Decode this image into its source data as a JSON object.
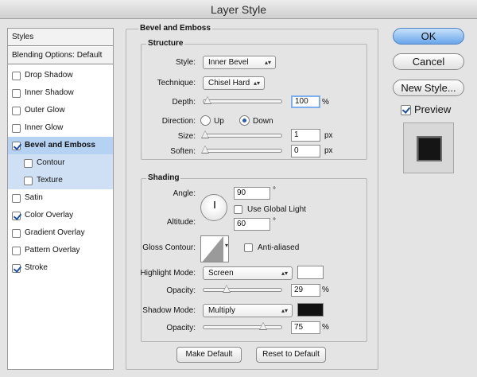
{
  "window": {
    "title": "Layer Style"
  },
  "styles_panel": {
    "header": "Styles",
    "blending": "Blending Options: Default",
    "items": [
      {
        "label": "Drop Shadow",
        "checked": false
      },
      {
        "label": "Inner Shadow",
        "checked": false
      },
      {
        "label": "Outer Glow",
        "checked": false
      },
      {
        "label": "Inner Glow",
        "checked": false
      },
      {
        "label": "Bevel and Emboss",
        "checked": true
      },
      {
        "label": "Contour",
        "checked": false
      },
      {
        "label": "Texture",
        "checked": false
      },
      {
        "label": "Satin",
        "checked": false
      },
      {
        "label": "Color Overlay",
        "checked": true
      },
      {
        "label": "Gradient Overlay",
        "checked": false
      },
      {
        "label": "Pattern Overlay",
        "checked": false
      },
      {
        "label": "Stroke",
        "checked": true
      }
    ]
  },
  "bevel": {
    "title": "Bevel and Emboss",
    "structure": {
      "title": "Structure",
      "style_label": "Style:",
      "style_value": "Inner Bevel",
      "technique_label": "Technique:",
      "technique_value": "Chisel Hard",
      "depth_label": "Depth:",
      "depth_value": "100",
      "depth_unit": "%",
      "depth_level": 0.0,
      "direction_label": "Direction:",
      "direction_up": "Up",
      "direction_down": "Down",
      "direction_selected": "Down",
      "size_label": "Size:",
      "size_value": "1",
      "size_unit": "px",
      "soften_label": "Soften:",
      "soften_value": "0",
      "soften_unit": "px"
    },
    "shading": {
      "title": "Shading",
      "angle_label": "Angle:",
      "angle_value": "90",
      "degree": "°",
      "global_light_label": "Use Global Light",
      "global_light_checked": false,
      "altitude_label": "Altitude:",
      "altitude_value": "60",
      "gloss_label": "Gloss Contour:",
      "anti_aliased_label": "Anti-aliased",
      "anti_aliased_checked": false,
      "highlight_mode_label": "Highlight Mode:",
      "highlight_mode_value": "Screen",
      "highlight_color": "#ffffff",
      "opacity_label": "Opacity:",
      "highlight_opacity": "29",
      "highlight_opacity_level": 0.29,
      "shadow_mode_label": "Shadow Mode:",
      "shadow_mode_value": "Multiply",
      "shadow_color": "#111111",
      "shadow_opacity": "75",
      "shadow_opacity_level": 0.75,
      "percent": "%"
    },
    "make_default": "Make Default",
    "reset_default": "Reset to Default"
  },
  "buttons": {
    "ok": "OK",
    "cancel": "Cancel",
    "new_style": "New Style...",
    "preview_label": "Preview",
    "preview_checked": true
  },
  "icons": {
    "popup_arrow": "updown-arrows-icon",
    "angle_dial": "angle-dial-icon",
    "gloss_contour": "contour-preview-icon"
  }
}
